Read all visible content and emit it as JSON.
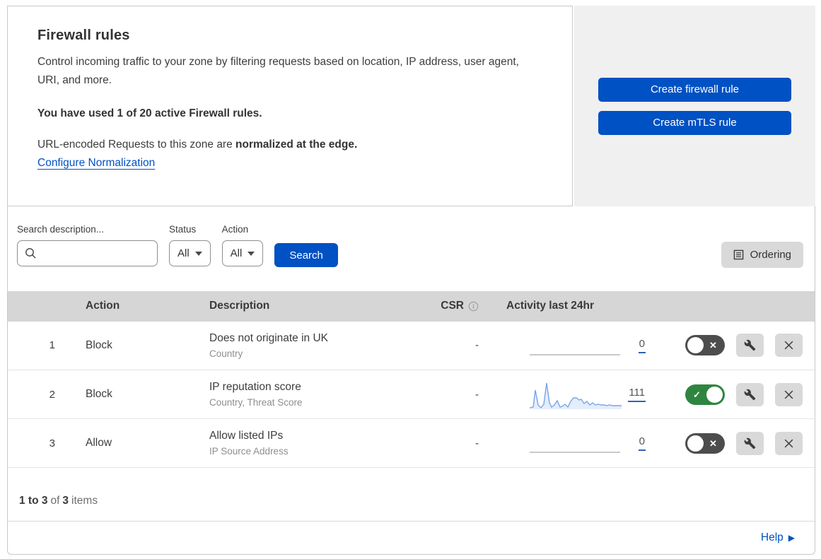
{
  "intro": {
    "title": "Firewall rules",
    "description": "Control incoming traffic to your zone by filtering requests based on location, IP address, user agent, URI, and more.",
    "usage_note": "You have used 1 of 20 active Firewall rules.",
    "normalization_prefix": "URL-encoded Requests to this zone are ",
    "normalization_bold": "normalized at the edge.",
    "normalization_link": "Configure Normalization"
  },
  "actions_panel": {
    "create_firewall_rule": "Create firewall rule",
    "create_mtls_rule": "Create mTLS rule"
  },
  "filters": {
    "search_label": "Search description...",
    "search_value": "",
    "status_label": "Status",
    "status_value": "All",
    "action_label": "Action",
    "action_value": "All",
    "search_button": "Search",
    "ordering_button": "Ordering"
  },
  "table": {
    "headers": {
      "action": "Action",
      "description": "Description",
      "csr": "CSR",
      "activity": "Activity last 24hr"
    },
    "rows": [
      {
        "priority": "1",
        "action": "Block",
        "description": "Does not originate in UK",
        "rule_fields": "Country",
        "csr": "-",
        "activity_count": "0",
        "enabled": false,
        "sparkline": null
      },
      {
        "priority": "2",
        "action": "Block",
        "description": "IP reputation score",
        "rule_fields": "Country, Threat Score",
        "csr": "-",
        "activity_count": "111",
        "enabled": true,
        "sparkline": [
          [
            0,
            42
          ],
          [
            5,
            41
          ],
          [
            8,
            17
          ],
          [
            12,
            38
          ],
          [
            16,
            42
          ],
          [
            20,
            37
          ],
          [
            24,
            7
          ],
          [
            28,
            35
          ],
          [
            31,
            41
          ],
          [
            35,
            38
          ],
          [
            39,
            32
          ],
          [
            43,
            41
          ],
          [
            46,
            40
          ],
          [
            50,
            37
          ],
          [
            54,
            41
          ],
          [
            58,
            33
          ],
          [
            62,
            28
          ],
          [
            66,
            28
          ],
          [
            70,
            31
          ],
          [
            73,
            30
          ],
          [
            77,
            36
          ],
          [
            81,
            33
          ],
          [
            85,
            38
          ],
          [
            89,
            35
          ],
          [
            93,
            38
          ],
          [
            97,
            37
          ],
          [
            101,
            38
          ],
          [
            105,
            38
          ],
          [
            109,
            39
          ],
          [
            113,
            38
          ],
          [
            117,
            39
          ],
          [
            121,
            39
          ],
          [
            126,
            39
          ],
          [
            130,
            39
          ]
        ]
      },
      {
        "priority": "3",
        "action": "Allow",
        "description": "Allow listed IPs",
        "rule_fields": "IP Source Address",
        "csr": "-",
        "activity_count": "0",
        "enabled": false,
        "sparkline": null
      }
    ]
  },
  "footer": {
    "range": "1 to 3",
    "of": "of",
    "total": "3",
    "items": "items",
    "help": "Help"
  },
  "colors": {
    "accent_blue": "#0051c3",
    "toggle_on": "#2e8540",
    "toggle_off": "#4d4d4d",
    "sparkline": "#7aa4e8",
    "sparkline_fill": "#e4edfa",
    "header_gray": "#d6d6d6",
    "panel_gray": "#f0f0f0"
  }
}
